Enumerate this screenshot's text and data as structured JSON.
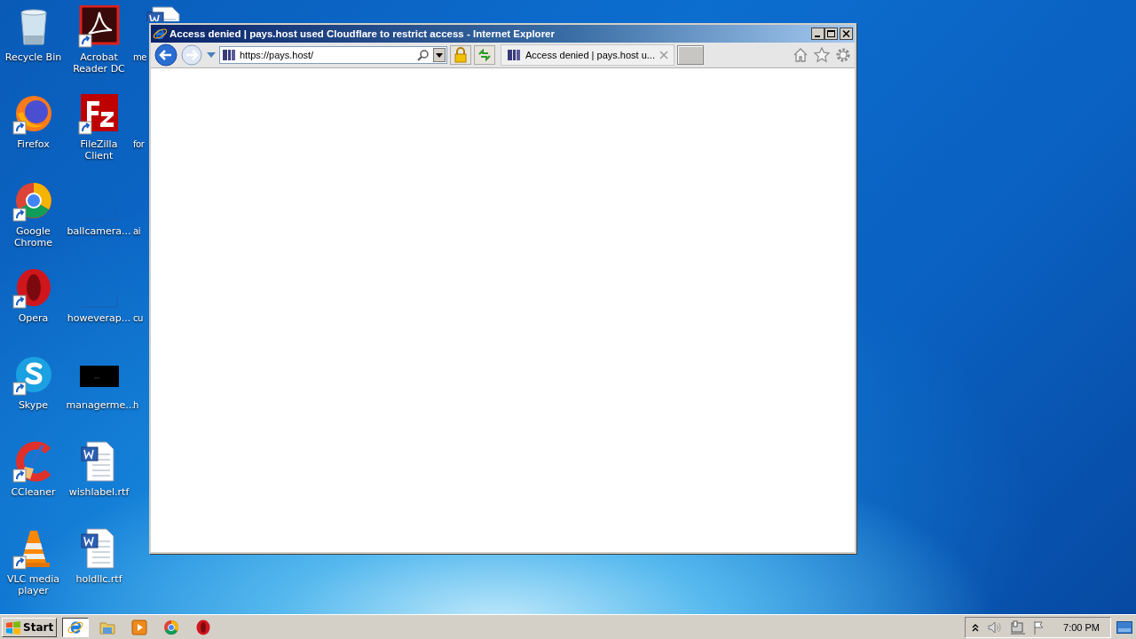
{
  "desktop": {
    "columns": [
      [
        {
          "label": "Recycle Bin",
          "kind": "recycle",
          "shortcut": false
        },
        {
          "label": "Firefox",
          "kind": "firefox",
          "shortcut": true
        },
        {
          "label": "Google Chrome",
          "kind": "chrome",
          "shortcut": true
        },
        {
          "label": "Opera",
          "kind": "opera",
          "shortcut": true
        },
        {
          "label": "Skype",
          "kind": "skype",
          "shortcut": true
        },
        {
          "label": "CCleaner",
          "kind": "ccleaner",
          "shortcut": true
        },
        {
          "label": "VLC media player",
          "kind": "vlc",
          "shortcut": true
        }
      ],
      [
        {
          "label": "Acrobat Reader DC",
          "kind": "acrobat",
          "shortcut": true
        },
        {
          "label": "FileZilla Client",
          "kind": "filezilla",
          "shortcut": true
        },
        {
          "label": "ballcamera...",
          "kind": "blank",
          "shortcut": false
        },
        {
          "label": "howeverap...",
          "kind": "blank",
          "shortcut": false
        },
        {
          "label": "managerme...",
          "kind": "console",
          "shortcut": false
        },
        {
          "label": "wishlabel.rtf",
          "kind": "word",
          "shortcut": false
        },
        {
          "label": "holdllc.rtf",
          "kind": "word",
          "shortcut": false
        }
      ],
      [
        {
          "label": "me",
          "kind": "word",
          "shortcut": false
        },
        {
          "label": "for",
          "kind": "doc",
          "shortcut": false
        },
        {
          "label": "ai",
          "kind": "doc",
          "shortcut": false
        },
        {
          "label": "cu",
          "kind": "doc",
          "shortcut": false
        },
        {
          "label": "h",
          "kind": "doc",
          "shortcut": false
        }
      ]
    ]
  },
  "window": {
    "title": "Access denied | pays.host used Cloudflare to restrict access - Internet Explorer",
    "address": "https://pays.host/",
    "tabs": [
      {
        "label": "Access denied | pays.host u...",
        "selected": true
      }
    ]
  },
  "taskbar": {
    "start": "Start",
    "apps": [
      {
        "kind": "ie",
        "selected": true
      },
      {
        "kind": "folder",
        "selected": false
      },
      {
        "kind": "media",
        "selected": false
      },
      {
        "kind": "chrome",
        "selected": false
      },
      {
        "kind": "opera",
        "selected": false
      }
    ],
    "clock": "7:00 PM"
  }
}
